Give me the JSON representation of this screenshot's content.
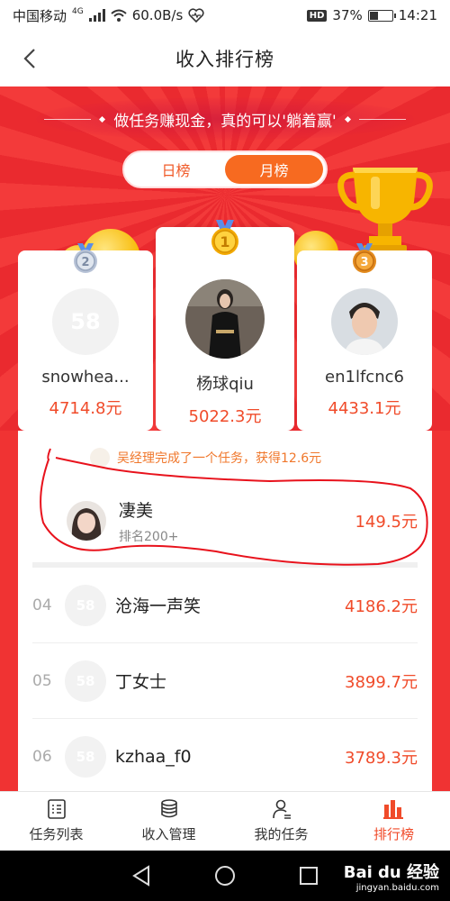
{
  "status_bar": {
    "carrier": "中国移动",
    "network": "4G",
    "speed": "60.0B/s",
    "hd": "HD",
    "battery": "37%",
    "battery_level": 0.37,
    "time": "14:21"
  },
  "header": {
    "title": "收入排行榜"
  },
  "hero": {
    "slogan": "做任务赚现金，真的可以'躺着赢'",
    "tabs": [
      {
        "label": "日榜",
        "active": false
      },
      {
        "label": "月榜",
        "active": true
      }
    ]
  },
  "podium": [
    {
      "rank": "2",
      "name": "snowhea...",
      "amount": "4714.8元",
      "avatar_text": "58"
    },
    {
      "rank": "1",
      "name": "杨球qiu",
      "amount": "5022.3元"
    },
    {
      "rank": "3",
      "name": "en1lfcnc6",
      "amount": "4433.1元"
    }
  ],
  "ticker": {
    "text": "吴经理完成了一个任务，获得12.6元"
  },
  "me": {
    "name": "凄美",
    "rank_text": "排名200+",
    "amount": "149.5元"
  },
  "ranking": [
    {
      "rank": "04",
      "name": "沧海一声笑",
      "amount": "4186.2元",
      "avatar_text": "58"
    },
    {
      "rank": "05",
      "name": "丁女士",
      "amount": "3899.7元",
      "avatar_text": "58"
    },
    {
      "rank": "06",
      "name": "kzhaa_f0",
      "amount": "3789.3元",
      "avatar_text": "58"
    }
  ],
  "tabbar": [
    {
      "label": "任务列表",
      "icon": "task-list-icon",
      "active": false
    },
    {
      "label": "收入管理",
      "icon": "coins-stack-icon",
      "active": false
    },
    {
      "label": "我的任务",
      "icon": "person-icon",
      "active": false
    },
    {
      "label": "排行榜",
      "icon": "bar-chart-icon",
      "active": true
    }
  ],
  "watermark": {
    "line1": "Bai du 经验",
    "line2": "jingyan.baidu.com"
  },
  "colors": {
    "accent": "#f04b2a",
    "hero_red": "#ef3232",
    "toggle_active": "#f76a20",
    "gold": "#f7b800"
  }
}
